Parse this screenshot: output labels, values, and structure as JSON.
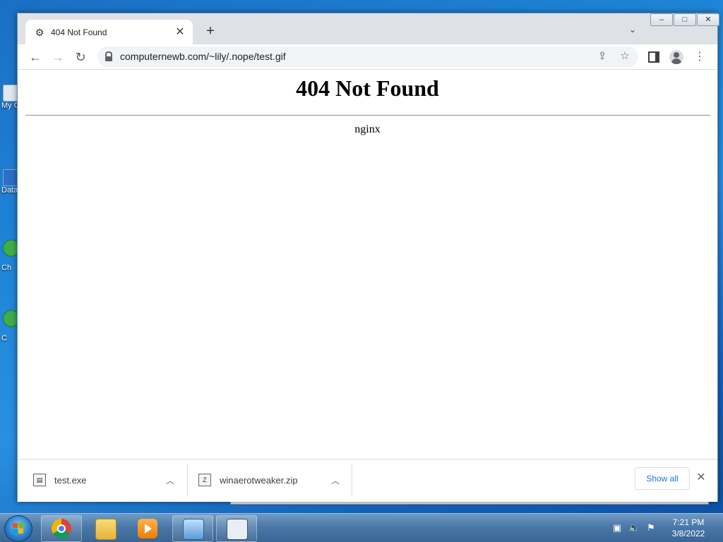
{
  "desktop": {
    "icons": [
      {
        "label": "My C",
        "icon": "computer-icon"
      },
      {
        "label": "Data",
        "icon": "shortcut-icon"
      },
      {
        "label": "Ch",
        "icon": "chrome-shortcut-icon"
      },
      {
        "label": "C",
        "icon": "chrome-shortcut-icon"
      }
    ]
  },
  "browser": {
    "tab": {
      "title": "404 Not Found",
      "favicon": "page-favicon-icon"
    },
    "window_controls": {
      "minimize": "–",
      "maximize": "□",
      "close": "✕"
    },
    "address": {
      "url": "computernewb.com/~lily/.nope/test.gif"
    },
    "page": {
      "heading": "404 Not Found",
      "server": "nginx"
    },
    "downloads": {
      "items": [
        {
          "name": "test.exe",
          "icon": "exe-file-icon"
        },
        {
          "name": "winaerotweaker.zip",
          "icon": "zip-file-icon"
        }
      ],
      "show_all_label": "Show all"
    }
  },
  "taskbar": {
    "apps": [
      "chrome",
      "windows-explorer",
      "media-player",
      "control-panel",
      "app"
    ],
    "clock": {
      "time": "7:21 PM",
      "date": "3/8/2022"
    }
  }
}
